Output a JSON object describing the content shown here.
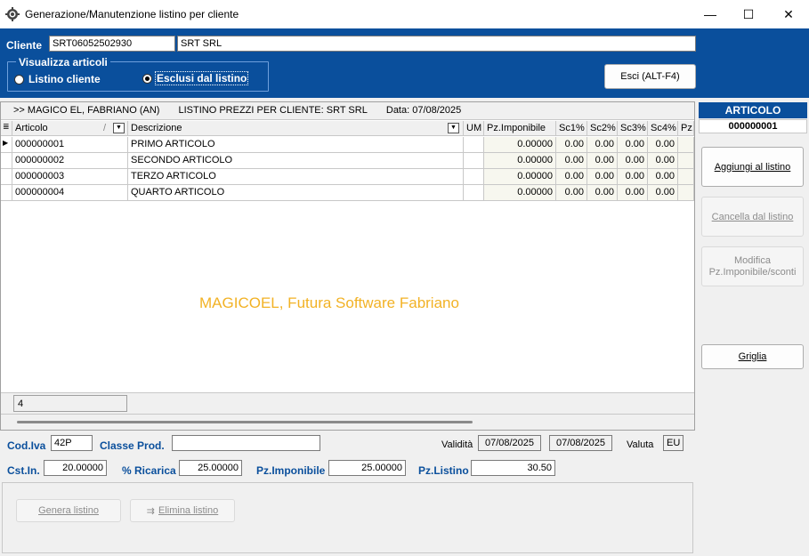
{
  "window": {
    "title": "Generazione/Manutenzione listino per cliente",
    "minimize_icon": "minimize-icon",
    "maximize_icon": "maximize-icon",
    "close_icon": "close-icon",
    "min_glyph": "—",
    "max_glyph": "☐",
    "close_glyph": "✕"
  },
  "cliente": {
    "label": "Cliente",
    "code": "SRT06052502930",
    "name": "SRT SRL"
  },
  "visualizza": {
    "title": "Visualizza articoli",
    "options": [
      {
        "label": "Listino cliente",
        "selected": false
      },
      {
        "label": "Esclusi dal listino",
        "selected": true
      }
    ]
  },
  "exit_button": "Esci (ALT-F4)",
  "grid": {
    "caption": {
      "company": ">> MAGICO EL, FABRIANO (AN)",
      "list_title": "LISTINO PREZZI PER CLIENTE: SRT SRL",
      "date": "Data: 07/08/2025"
    },
    "columns": [
      "Articolo",
      "Descrizione",
      "UM",
      "Pz.Imponibile",
      "Sc1%",
      "Sc2%",
      "Sc3%",
      "Sc4%",
      "Pz."
    ],
    "sort_glyph": "/",
    "rows": [
      {
        "articolo": "000000001",
        "descrizione": "PRIMO ARTICOLO",
        "um": "",
        "pz_imponibile": "0.00000",
        "sc1": "0.00",
        "sc2": "0.00",
        "sc3": "0.00",
        "sc4": "0.00"
      },
      {
        "articolo": "000000002",
        "descrizione": "SECONDO ARTICOLO",
        "um": "",
        "pz_imponibile": "0.00000",
        "sc1": "0.00",
        "sc2": "0.00",
        "sc3": "0.00",
        "sc4": "0.00"
      },
      {
        "articolo": "000000003",
        "descrizione": "TERZO ARTICOLO",
        "um": "",
        "pz_imponibile": "0.00000",
        "sc1": "0.00",
        "sc2": "0.00",
        "sc3": "0.00",
        "sc4": "0.00"
      },
      {
        "articolo": "000000004",
        "descrizione": "QUARTO ARTICOLO",
        "um": "",
        "pz_imponibile": "0.00000",
        "sc1": "0.00",
        "sc2": "0.00",
        "sc3": "0.00",
        "sc4": "0.00"
      }
    ],
    "watermark": "MAGICOEL, Futura Software Fabriano",
    "record_count": "4"
  },
  "side": {
    "header": "ARTICOLO",
    "code": "000000001",
    "buttons": {
      "aggiungi": "Aggiungi al listino",
      "cancella": "Cancella dal listino",
      "modifica": "Modifica Pz.Imponibile/sconti",
      "griglia": "Griglia"
    }
  },
  "detail": {
    "cod_iva_label": "Cod.Iva",
    "cod_iva": "42P",
    "classe_prod_label": "Classe Prod.",
    "classe_prod": "",
    "validita_label": "Validità",
    "validita_from": "07/08/2025",
    "validita_to": "07/08/2025",
    "valuta_label": "Valuta",
    "valuta": "EU",
    "cst_in_label": "Cst.In.",
    "cst_in": "20.00000",
    "ricarica_label": "% Ricarica",
    "ricarica": "25.00000",
    "pz_imponibile_label": "Pz.Imponibile",
    "pz_imponibile": "25.00000",
    "pz_listino_label": "Pz.Listino",
    "pz_listino": "30.50"
  },
  "actions": {
    "genera": "Genera listino",
    "elimina": "Elimina listino"
  },
  "colors": {
    "panel_blue": "#0a4f9c",
    "label_blue": "#0a4f9c",
    "watermark": "#f2b225"
  }
}
